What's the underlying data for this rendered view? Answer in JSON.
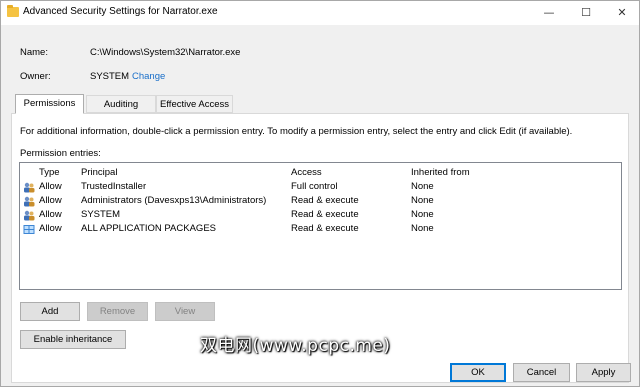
{
  "window": {
    "title": "Advanced Security Settings for Narrator.exe",
    "min_glyph": "—",
    "max_glyph": "☐",
    "close_glyph": "✕"
  },
  "name": {
    "label": "Name:",
    "value": "C:\\Windows\\System32\\Narrator.exe"
  },
  "owner": {
    "label": "Owner:",
    "value": "SYSTEM",
    "change_link": "Change"
  },
  "tabs": [
    {
      "label": "Permissions"
    },
    {
      "label": "Auditing"
    },
    {
      "label": "Effective Access"
    }
  ],
  "info_text": "For additional information, double-click a permission entry. To modify a permission entry, select the entry and click Edit (if available).",
  "entries_label": "Permission entries:",
  "columns": {
    "type": "Type",
    "principal": "Principal",
    "access": "Access",
    "inherited": "Inherited from"
  },
  "entries": [
    {
      "icon": "user-group-icon",
      "type": "Allow",
      "principal": "TrustedInstaller",
      "access": "Full control",
      "inherited": "None"
    },
    {
      "icon": "user-group-icon",
      "type": "Allow",
      "principal": "Administrators (Davesxps13\\Administrators)",
      "access": "Read & execute",
      "inherited": "None"
    },
    {
      "icon": "user-group-icon",
      "type": "Allow",
      "principal": "SYSTEM",
      "access": "Read & execute",
      "inherited": "None"
    },
    {
      "icon": "app-packages-icon",
      "type": "Allow",
      "principal": "ALL APPLICATION PACKAGES",
      "access": "Read & execute",
      "inherited": "None"
    }
  ],
  "buttons": {
    "add": "Add",
    "remove": "Remove",
    "view": "View",
    "enable_inheritance": "Enable inheritance",
    "ok": "OK",
    "cancel": "Cancel",
    "apply": "Apply"
  },
  "watermark": "双电网(www.pcpc.me)",
  "colors": {
    "link": "#1a6fc9",
    "window_bg": "#f0f0f0",
    "focus": "#0078d7"
  }
}
